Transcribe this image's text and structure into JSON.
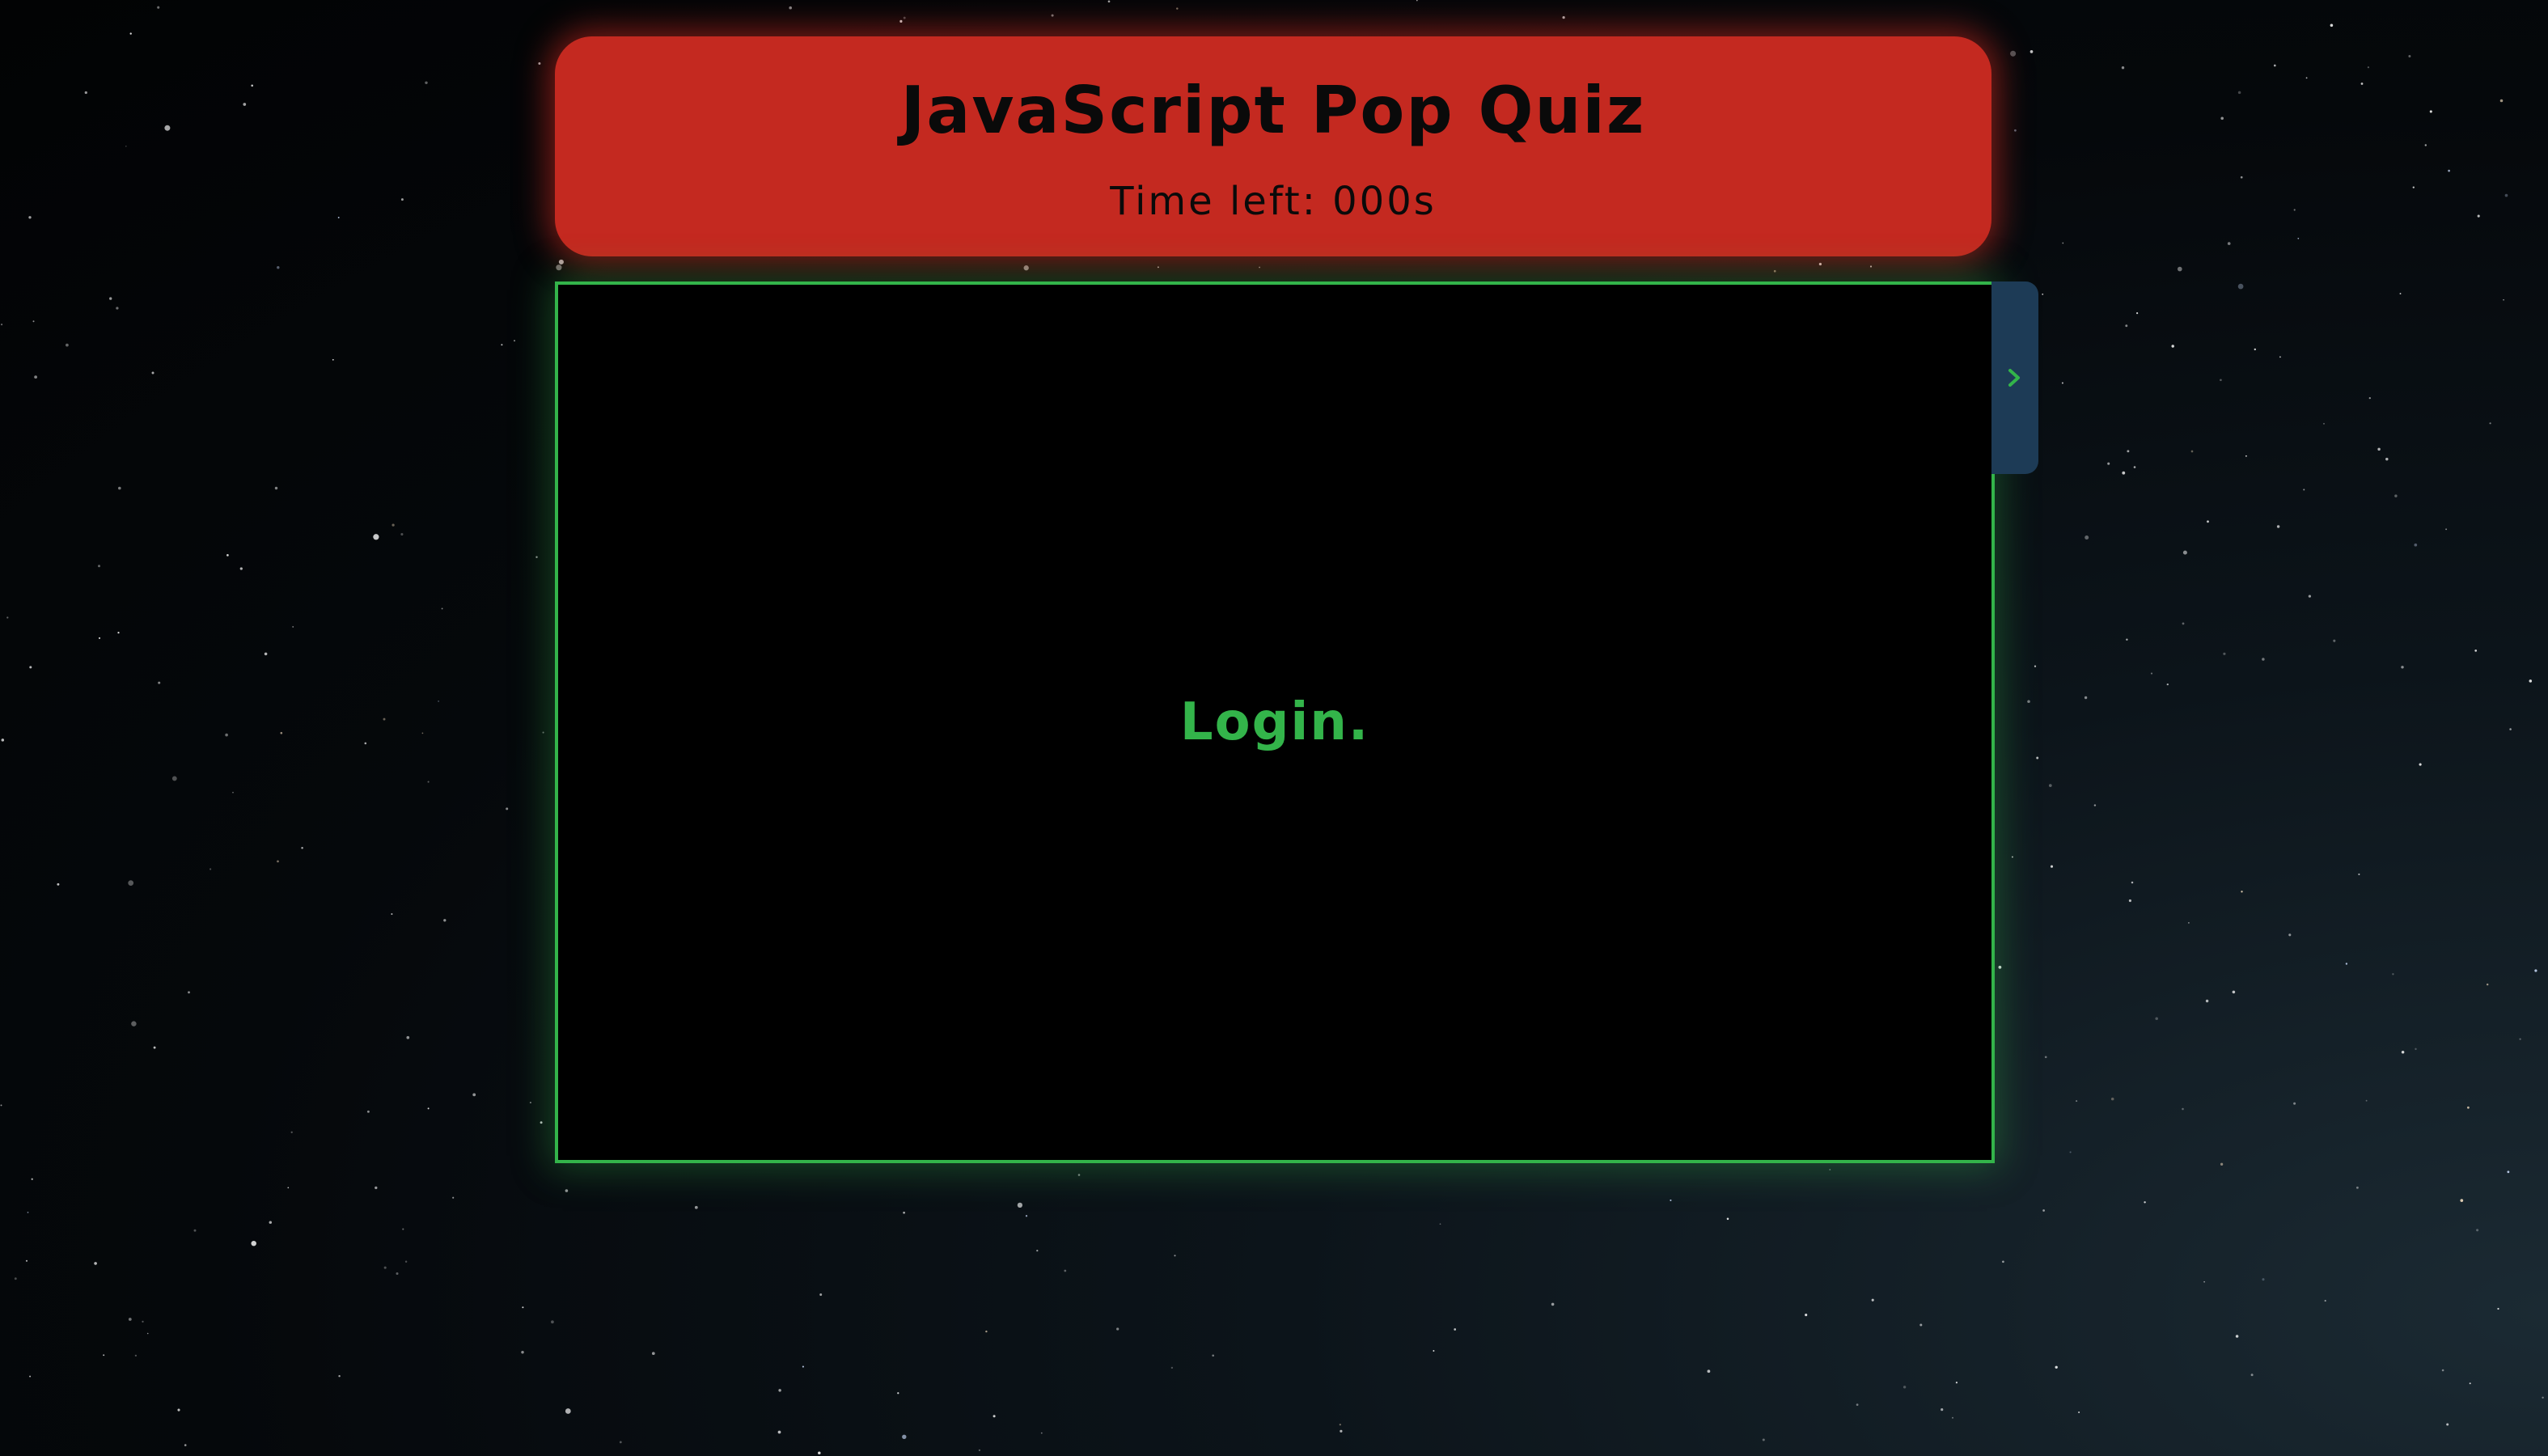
{
  "header": {
    "title": "JavaScript Pop Quiz",
    "timer": "Time left: 000s"
  },
  "panel": {
    "message": "Login."
  },
  "side_tab": {
    "icon": "chevron-right-icon"
  },
  "colors": {
    "header_bg": "#c42920",
    "accent_green": "#33b44a",
    "side_tab_bg": "#1d3b56",
    "panel_bg": "#000000"
  }
}
